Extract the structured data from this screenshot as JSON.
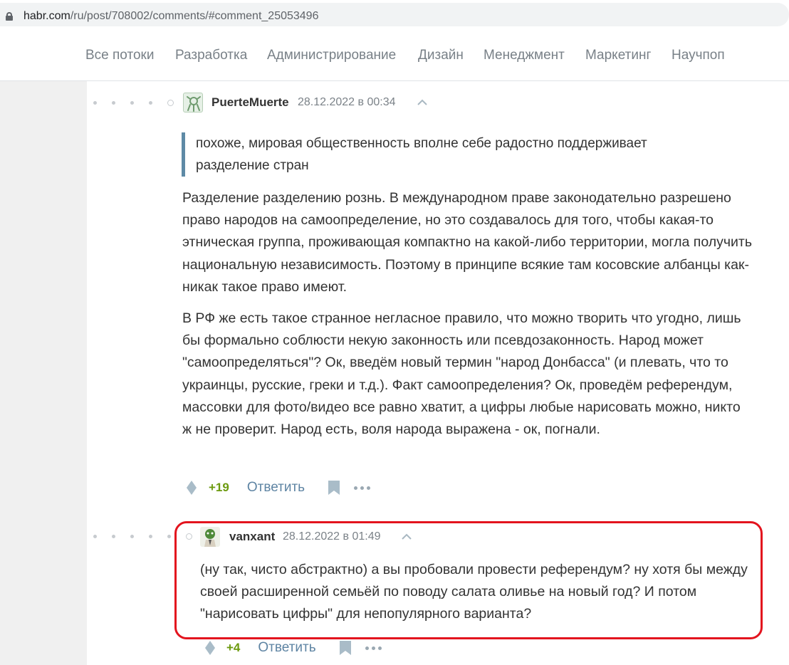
{
  "browser": {
    "url_host": "habr.com",
    "url_path": "/ru/post/708002/comments/#comment_25053496"
  },
  "nav": {
    "items": [
      "Все потоки",
      "Разработка",
      "Администрирование",
      "Дизайн",
      "Менеджмент",
      "Маркетинг",
      "Научпоп"
    ]
  },
  "comment1": {
    "author": "PuerteMuerte",
    "date": "28.12.2022 в 00:34",
    "quote": "похоже, мировая общественность вполне себе радостно поддерживает разделение стран",
    "paragraphs": [
      "Разделение разделению рознь. В международном праве законодательно разрешено право народов на самоопределение, но это создавалось для того, чтобы какая-то этническая группа, проживающая компактно на какой-либо территории, могла получить национальную независимость. Поэтому в принципе всякие там косовские албанцы как-никак такое право имеют.",
      "В РФ же есть такое странное негласное правило, что можно творить что угодно, лишь бы формально соблюсти некую законность или псевдозаконность. Народ может \"самоопределяться\"? Ок, введём новый термин \"народ Донбасса\" (и плевать, что то украинцы, русские, греки и т.д.). Факт самоопределения? Ок, проведём референдум, массовки для фото/видео все равно хватит, а цифры любые нарисовать можно, никто ж не проверит. Народ есть, воля народа выражена - ок, погнали."
    ],
    "score": "+19",
    "reply_label": "Ответить"
  },
  "comment2": {
    "author": "vanxant",
    "date": "28.12.2022 в 01:49",
    "text": "(ну так, чисто абстрактно) а вы пробовали провести референдум? ну хотя бы между своей расширенной семьёй по поводу салата оливье на новый год? И потом \"нарисовать цифры\" для непопулярного варианта?",
    "score": "+4",
    "reply_label": "Ответить"
  },
  "colors": {
    "accent_link": "#5e84a3",
    "score_green": "#6c9a0f",
    "quote_bar": "#5e8aa6",
    "highlight_red": "#e3141e"
  }
}
